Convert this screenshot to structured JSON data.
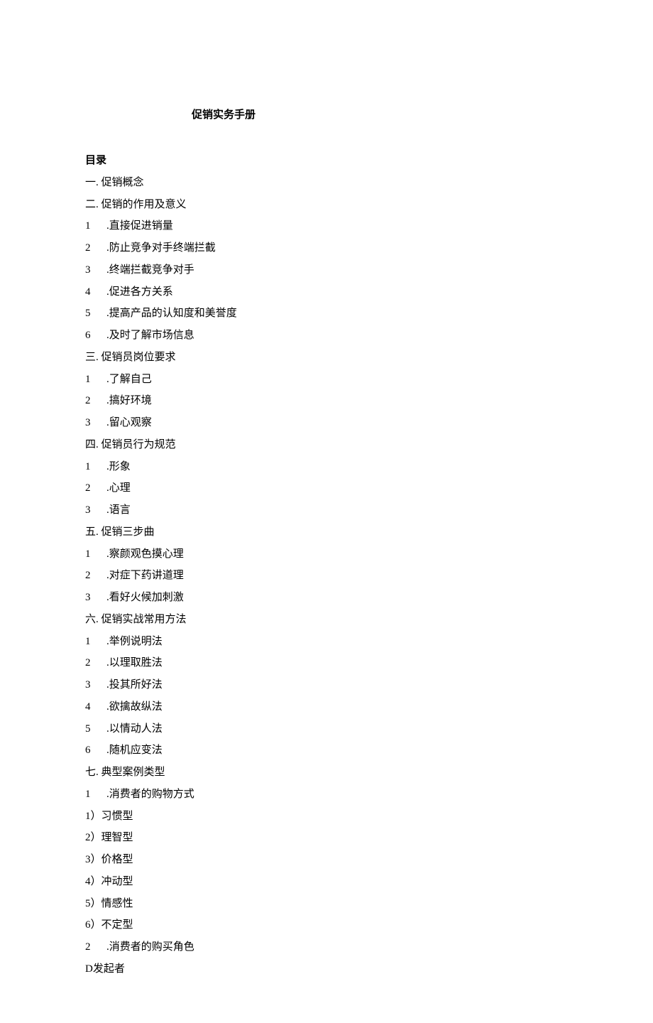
{
  "title": "促销实务手册",
  "toc_header": "目录",
  "sections": [
    {
      "heading": "一. 促销概念",
      "items": []
    },
    {
      "heading": "二. 促销的作用及意义",
      "items": [
        {
          "num": "1",
          "text": ".直接促进销量"
        },
        {
          "num": "2",
          "text": ".防止竞争对手终端拦截"
        },
        {
          "num": "3",
          "text": ".终端拦截竞争对手"
        },
        {
          "num": "4",
          "text": ".促进各方关系"
        },
        {
          "num": "5",
          "text": ".提高产品的认知度和美誉度"
        },
        {
          "num": "6",
          "text": ".及时了解市场信息"
        }
      ]
    },
    {
      "heading": "三. 促销员岗位要求",
      "items": [
        {
          "num": "1",
          "text": ".了解自己"
        },
        {
          "num": "2",
          "text": ".搞好环境"
        },
        {
          "num": "3",
          "text": ".留心观察"
        }
      ]
    },
    {
      "heading": "四. 促销员行为规范",
      "items": [
        {
          "num": "1",
          "text": ".形象"
        },
        {
          "num": "2",
          "text": ".心理"
        },
        {
          "num": "3",
          "text": ".语言"
        }
      ]
    },
    {
      "heading": "五. 促销三步曲",
      "items": [
        {
          "num": "1",
          "text": ".察颜观色摸心理"
        },
        {
          "num": "2",
          "text": ".对症下药讲道理"
        },
        {
          "num": "3",
          "text": ".看好火候加刺激"
        }
      ]
    },
    {
      "heading": "六. 促销实战常用方法",
      "items": [
        {
          "num": "1",
          "text": ".举例说明法"
        },
        {
          "num": "2",
          "text": ".以理取胜法"
        },
        {
          "num": "3",
          "text": ".投其所好法"
        },
        {
          "num": "4",
          "text": ".欲擒故纵法"
        },
        {
          "num": "5",
          "text": ".以情动人法"
        },
        {
          "num": "6",
          "text": ".随机应变法"
        }
      ]
    },
    {
      "heading": "七. 典型案例类型",
      "items": [
        {
          "num": "1",
          "text": ".消费者的购物方式"
        },
        {
          "num": "1）",
          "text": "习惯型",
          "sub": true
        },
        {
          "num": "2）",
          "text": "理智型",
          "sub": true
        },
        {
          "num": "3）",
          "text": "价格型",
          "sub": true
        },
        {
          "num": "4）",
          "text": "冲动型",
          "sub": true
        },
        {
          "num": "5）",
          "text": "情感性",
          "sub": true
        },
        {
          "num": "6）",
          "text": "不定型",
          "sub": true
        },
        {
          "num": "2",
          "text": ".消费者的购买角色"
        },
        {
          "num": "D",
          "text": "发起者",
          "sub": true
        }
      ]
    }
  ]
}
